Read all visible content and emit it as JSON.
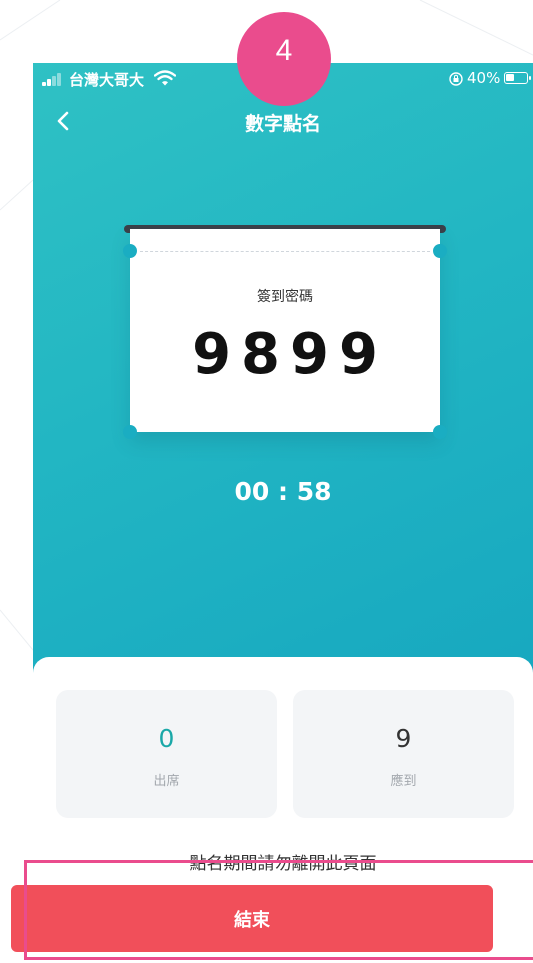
{
  "step_badge": "4",
  "status_bar": {
    "carrier": "台灣大哥大",
    "battery_pct": "40%"
  },
  "nav": {
    "title": "數字點名"
  },
  "ticket": {
    "label": "簽到密碼",
    "code": "9899"
  },
  "timer": "00 : 58",
  "stats": {
    "attended": {
      "value": "0",
      "label": "出席",
      "color": "#1aa8a8"
    },
    "expected": {
      "value": "9",
      "label": "應到",
      "color": "#333333"
    }
  },
  "notice": "點名期間請勿離開此頁面",
  "end_button_label": "結束",
  "colors": {
    "teal": "#1db2c2",
    "end_button": "#f14f5a",
    "highlight": "#ea4c8d"
  }
}
